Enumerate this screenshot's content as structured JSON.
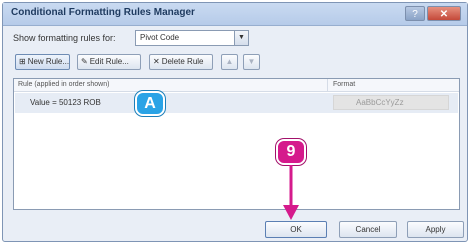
{
  "window": {
    "title": "Conditional Formatting Rules Manager",
    "help_label": "?",
    "close_label": "✕"
  },
  "show_rules": {
    "label": "Show formatting rules for:",
    "selected": "Pivot Code",
    "dropdown_glyph": "▼"
  },
  "toolbar": {
    "new_rule": "New Rule...",
    "edit_rule": "Edit Rule...",
    "delete_rule": "Delete Rule",
    "new_icon": "⊞",
    "edit_icon": "✎",
    "delete_icon": "✕",
    "move_up": "▲",
    "move_down": "▼"
  },
  "rules_table": {
    "columns": {
      "rule": "Rule (applied in order shown)",
      "format": "Format"
    },
    "rows": [
      {
        "rule": "Value = 50123 ROB",
        "format_preview": "AaBbCcYyZz"
      }
    ]
  },
  "buttons": {
    "ok": "OK",
    "cancel": "Cancel",
    "apply": "Apply"
  },
  "callouts": {
    "a": "A",
    "nine": "9"
  },
  "colors": {
    "callout_a": "#2aa3e6",
    "callout_9": "#d51a8c",
    "arrow": "#d51a8c"
  }
}
